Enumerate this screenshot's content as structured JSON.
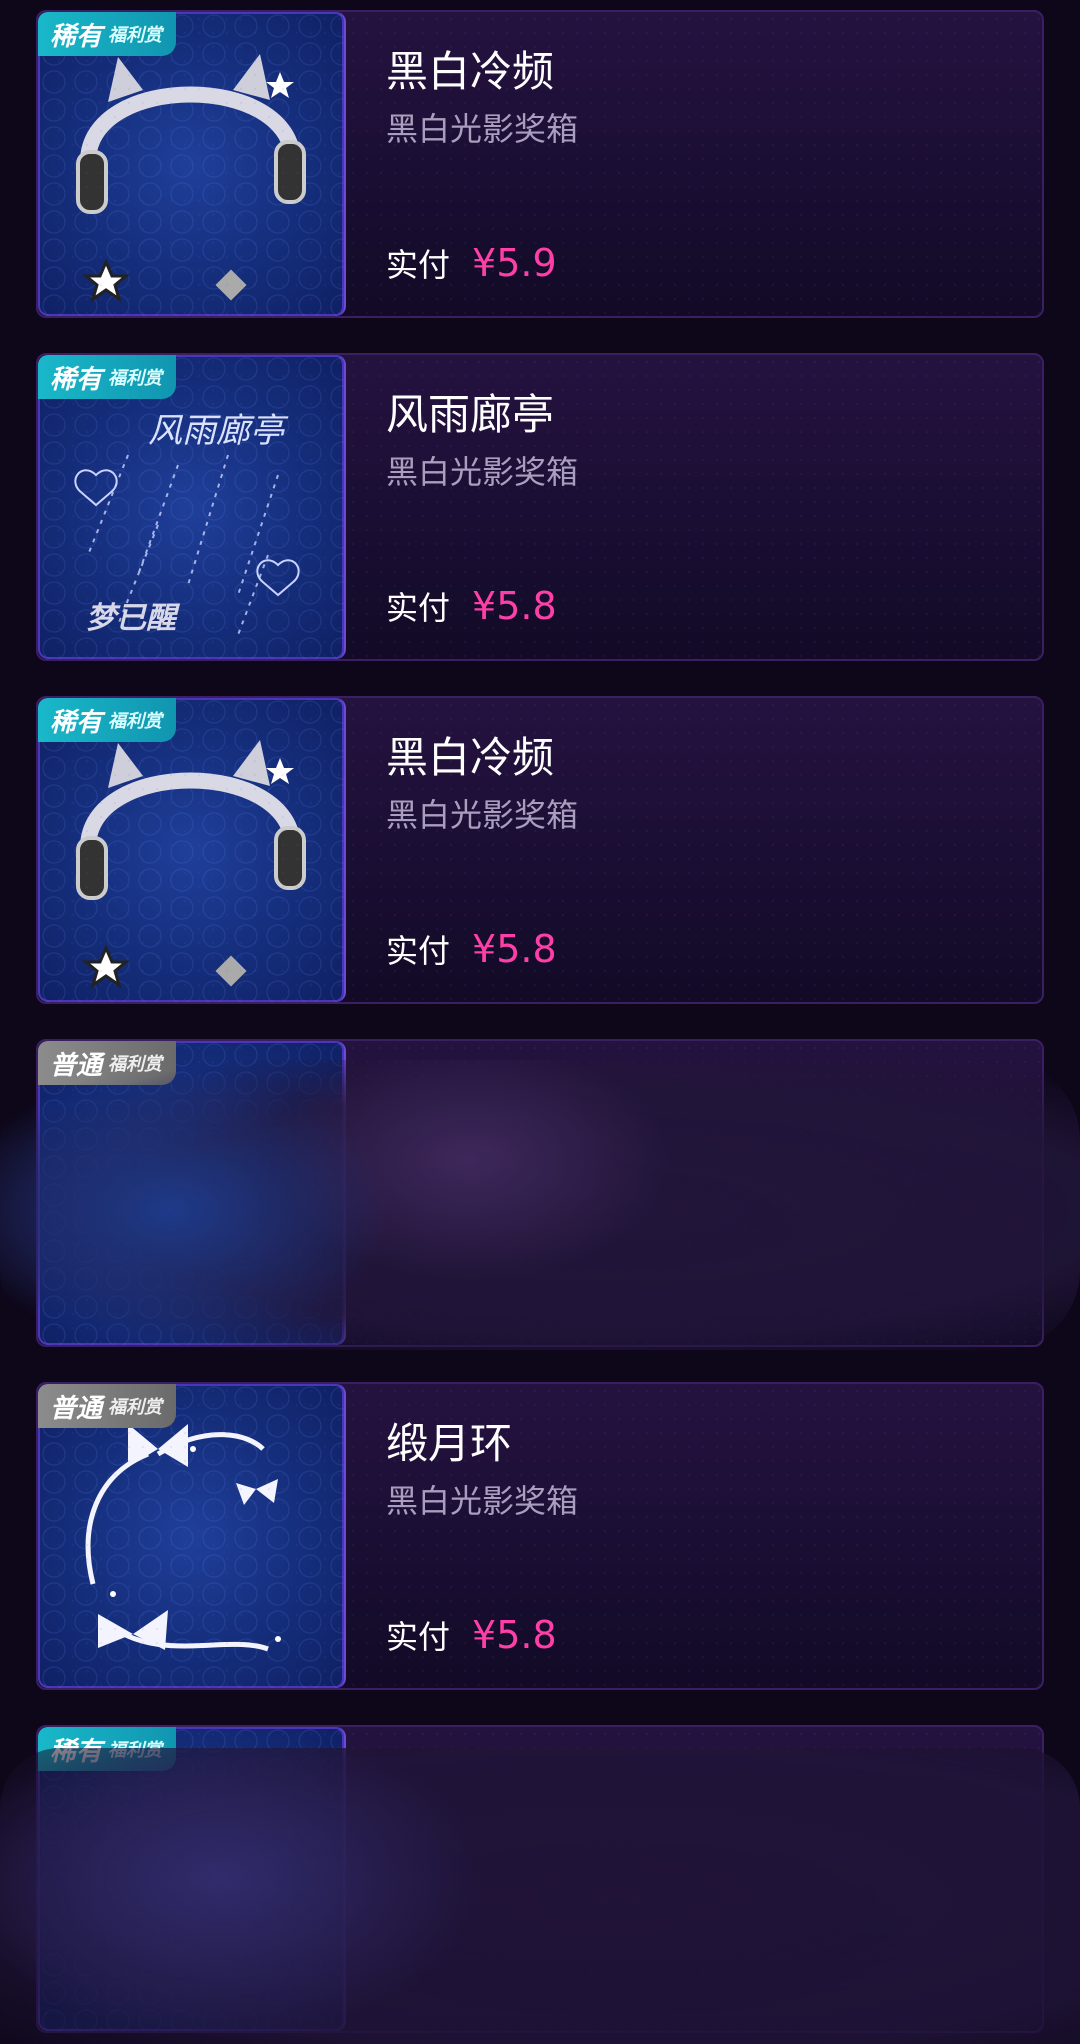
{
  "cards": [
    {
      "badge": "稀有",
      "badge_sub": "福利赏",
      "title": "黑白冷频",
      "subtitle": "黑白光影奖箱",
      "price_label": "实付",
      "price": "¥5.9"
    },
    {
      "badge": "稀有",
      "badge_sub": "福利赏",
      "title": "风雨廊亭",
      "subtitle": "黑白光影奖箱",
      "price_label": "实付",
      "price": "¥5.8",
      "art_title": "风雨廊亭",
      "art_sign": "梦已醒"
    },
    {
      "badge": "稀有",
      "badge_sub": "福利赏",
      "title": "黑白冷频",
      "subtitle": "黑白光影奖箱",
      "price_label": "实付",
      "price": "¥5.8"
    },
    {
      "badge": "普通",
      "badge_sub": "福利赏"
    },
    {
      "badge": "普通",
      "badge_sub": "福利赏",
      "title": "缎月环",
      "subtitle": "黑白光影奖箱",
      "price_label": "实付",
      "price": "¥5.8"
    },
    {
      "badge": "稀有",
      "badge_sub": "福利赏"
    }
  ]
}
